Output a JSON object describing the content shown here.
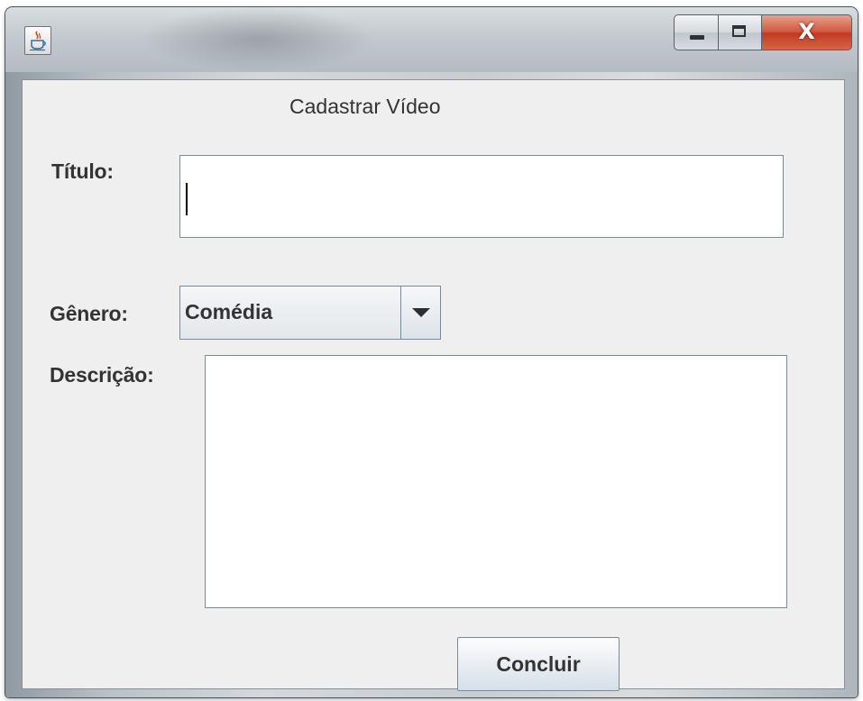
{
  "window": {
    "title": "",
    "icon": "java-cup-icon",
    "controls": {
      "minimize_icon": "minimize-icon",
      "maximize_icon": "maximize-icon",
      "close_label": "X"
    }
  },
  "form": {
    "heading": "Cadastrar Vídeo",
    "titulo": {
      "label": "Título:",
      "value": ""
    },
    "genero": {
      "label": "Gênero:",
      "selected": "Comédia",
      "arrow_icon": "chevron-down-icon"
    },
    "descricao": {
      "label": "Descrição:",
      "value": ""
    },
    "submit_label": "Concluir"
  },
  "colors": {
    "client_background": "#efefef",
    "close_button": "#c23a1f",
    "field_border": "#7a8a99"
  }
}
